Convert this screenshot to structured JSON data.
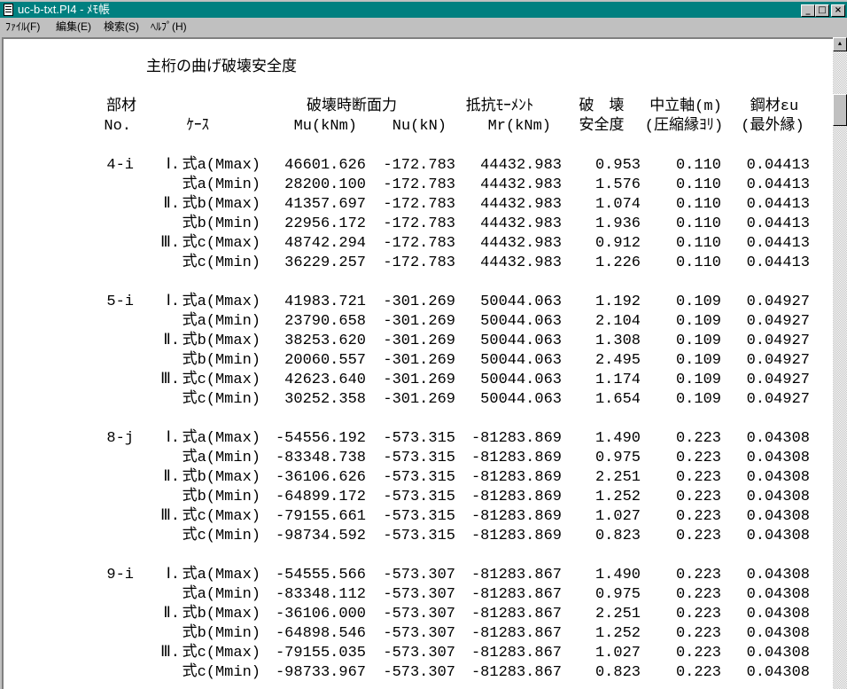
{
  "window": {
    "title": "uc-b-txt.PI4 - ﾒﾓ帳"
  },
  "menu": [
    "ﾌｧｲﾙ(F)",
    "編集(E)",
    "検索(S)",
    "ﾍﾙﾌﾟ(H)"
  ],
  "doc": {
    "title": "主桁の曲げ破壊安全度",
    "headers": {
      "member1": "部材",
      "member2": "No.",
      "case": "ｹｰｽ",
      "force": "破壊時断面力",
      "mu": "Mu(kNm)",
      "nu": "Nu(kN)",
      "resist": "抵抗ﾓｰﾒﾝﾄ",
      "mr": "Mr(kNm)",
      "sf1": "破　壊",
      "sf2": "安全度",
      "na1": "中立軸(m)",
      "na2": "(圧縮縁ﾖﾘ)",
      "eps1": "鋼材εu",
      "eps2": "(最外縁)"
    },
    "blocks": [
      {
        "member": "4-i",
        "rows": [
          [
            "Ⅰ.",
            "式a(Mmax)",
            "46601.626",
            "-172.783",
            "44432.983",
            "0.953",
            "0.110",
            "0.04413"
          ],
          [
            "",
            "式a(Mmin)",
            "28200.100",
            "-172.783",
            "44432.983",
            "1.576",
            "0.110",
            "0.04413"
          ],
          [
            "Ⅱ.",
            "式b(Mmax)",
            "41357.697",
            "-172.783",
            "44432.983",
            "1.074",
            "0.110",
            "0.04413"
          ],
          [
            "",
            "式b(Mmin)",
            "22956.172",
            "-172.783",
            "44432.983",
            "1.936",
            "0.110",
            "0.04413"
          ],
          [
            "Ⅲ.",
            "式c(Mmax)",
            "48742.294",
            "-172.783",
            "44432.983",
            "0.912",
            "0.110",
            "0.04413"
          ],
          [
            "",
            "式c(Mmin)",
            "36229.257",
            "-172.783",
            "44432.983",
            "1.226",
            "0.110",
            "0.04413"
          ]
        ]
      },
      {
        "member": "5-i",
        "rows": [
          [
            "Ⅰ.",
            "式a(Mmax)",
            "41983.721",
            "-301.269",
            "50044.063",
            "1.192",
            "0.109",
            "0.04927"
          ],
          [
            "",
            "式a(Mmin)",
            "23790.658",
            "-301.269",
            "50044.063",
            "2.104",
            "0.109",
            "0.04927"
          ],
          [
            "Ⅱ.",
            "式b(Mmax)",
            "38253.620",
            "-301.269",
            "50044.063",
            "1.308",
            "0.109",
            "0.04927"
          ],
          [
            "",
            "式b(Mmin)",
            "20060.557",
            "-301.269",
            "50044.063",
            "2.495",
            "0.109",
            "0.04927"
          ],
          [
            "Ⅲ.",
            "式c(Mmax)",
            "42623.640",
            "-301.269",
            "50044.063",
            "1.174",
            "0.109",
            "0.04927"
          ],
          [
            "",
            "式c(Mmin)",
            "30252.358",
            "-301.269",
            "50044.063",
            "1.654",
            "0.109",
            "0.04927"
          ]
        ]
      },
      {
        "member": "8-j",
        "rows": [
          [
            "Ⅰ.",
            "式a(Mmax)",
            "-54556.192",
            "-573.315",
            "-81283.869",
            "1.490",
            "0.223",
            "0.04308"
          ],
          [
            "",
            "式a(Mmin)",
            "-83348.738",
            "-573.315",
            "-81283.869",
            "0.975",
            "0.223",
            "0.04308"
          ],
          [
            "Ⅱ.",
            "式b(Mmax)",
            "-36106.626",
            "-573.315",
            "-81283.869",
            "2.251",
            "0.223",
            "0.04308"
          ],
          [
            "",
            "式b(Mmin)",
            "-64899.172",
            "-573.315",
            "-81283.869",
            "1.252",
            "0.223",
            "0.04308"
          ],
          [
            "Ⅲ.",
            "式c(Mmax)",
            "-79155.661",
            "-573.315",
            "-81283.869",
            "1.027",
            "0.223",
            "0.04308"
          ],
          [
            "",
            "式c(Mmin)",
            "-98734.592",
            "-573.315",
            "-81283.869",
            "0.823",
            "0.223",
            "0.04308"
          ]
        ]
      },
      {
        "member": "9-i",
        "rows": [
          [
            "Ⅰ.",
            "式a(Mmax)",
            "-54555.566",
            "-573.307",
            "-81283.867",
            "1.490",
            "0.223",
            "0.04308"
          ],
          [
            "",
            "式a(Mmin)",
            "-83348.112",
            "-573.307",
            "-81283.867",
            "0.975",
            "0.223",
            "0.04308"
          ],
          [
            "Ⅱ.",
            "式b(Mmax)",
            "-36106.000",
            "-573.307",
            "-81283.867",
            "2.251",
            "0.223",
            "0.04308"
          ],
          [
            "",
            "式b(Mmin)",
            "-64898.546",
            "-573.307",
            "-81283.867",
            "1.252",
            "0.223",
            "0.04308"
          ],
          [
            "Ⅲ.",
            "式c(Mmax)",
            "-79155.035",
            "-573.307",
            "-81283.867",
            "1.027",
            "0.223",
            "0.04308"
          ],
          [
            "",
            "式c(Mmin)",
            "-98733.967",
            "-573.307",
            "-81283.867",
            "0.823",
            "0.223",
            "0.04308"
          ]
        ]
      }
    ]
  }
}
